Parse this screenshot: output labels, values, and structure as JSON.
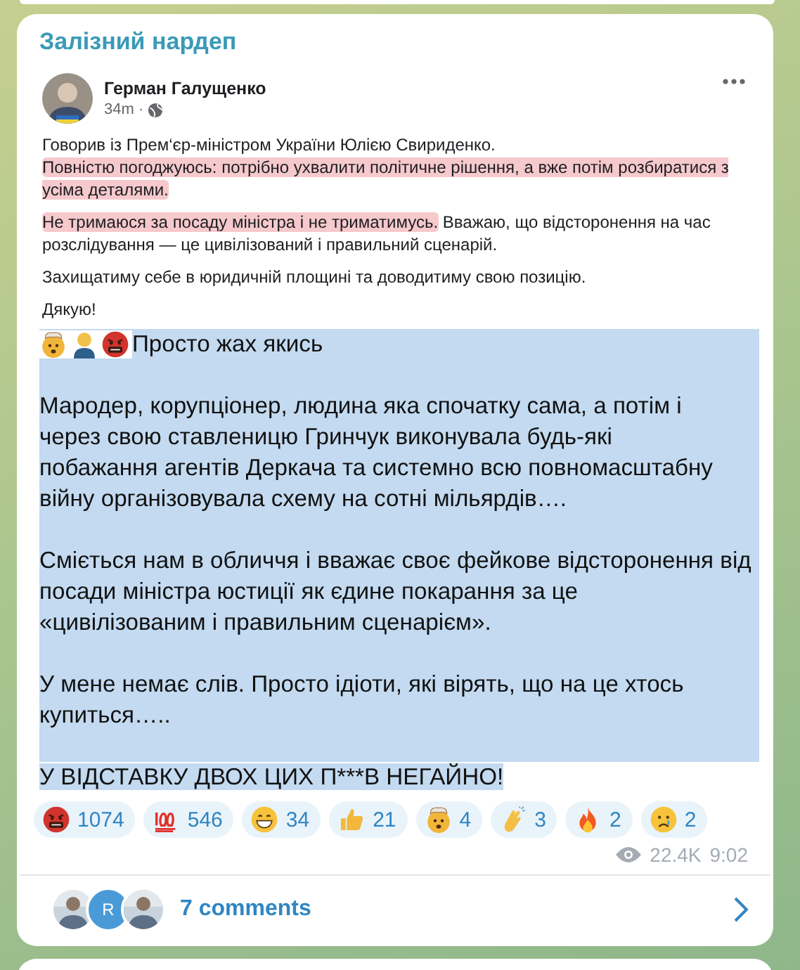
{
  "channel": {
    "title": "Залізний нардеп"
  },
  "post": {
    "author": "Герман Галущенко",
    "time": "34m ·",
    "paragraphs": [
      [
        {
          "text": "Говорив із Прем‘єр-міністром України Юлією Свириденко.",
          "highlighted": false
        },
        {
          "text": "Повністю погоджуюсь: потрібно ухвалити політичне рішення, а вже потім розбиратися з усіма деталями.",
          "highlighted": true
        }
      ],
      [
        {
          "text": "Не тримаюся за посаду міністра і не триматимусь.",
          "highlighted": true
        },
        {
          "text": " Вважаю, що відсторонення на час розслідування — це цивілізований і правильний сценарій.",
          "highlighted": false
        }
      ],
      [
        {
          "text": "Захищатиму себе в юридичній площині та доводитиму свою позицію.",
          "highlighted": false
        }
      ],
      [
        {
          "text": "Дякую!",
          "highlighted": false
        }
      ]
    ]
  },
  "message": {
    "selected": true,
    "lead_emoji": [
      {
        "kind": "mind-blown"
      },
      {
        "kind": "bald-person"
      },
      {
        "kind": "cursing"
      }
    ],
    "paragraphs": [
      [
        "Просто жах якись"
      ],
      [
        "Мародер, корупціонер, людина яка спочатку сама, а потім і",
        "через свою ставленицю Гринчук виконувала будь-які",
        "побажання агентів Деркача та системно всю повномасштабну",
        "війну організовувала схему на сотні мільярдів…."
      ],
      [
        "Сміється нам в обличчя і вважає своє фейкове відсторонення від",
        "посади міністра юстиції як єдине покарання за це",
        "«цивілізованим і правильним сценарієм»."
      ],
      [
        "У мене немає слів. Просто ідіоти, які вірять, що на це хтось",
        "купиться….."
      ],
      [
        "У ВІДСТАВКУ ДВОХ ЦИХ П***В НЕГАЙНО!"
      ]
    ]
  },
  "reactions": [
    {
      "kind": "cursing",
      "count": "1074"
    },
    {
      "kind": "hundred",
      "count": "546"
    },
    {
      "kind": "grin",
      "count": "34"
    },
    {
      "kind": "thumbs-up",
      "count": "21"
    },
    {
      "kind": "mind-blown",
      "count": "4"
    },
    {
      "kind": "clap",
      "count": "3"
    },
    {
      "kind": "fire",
      "count": "2"
    },
    {
      "kind": "cry",
      "count": "2"
    }
  ],
  "views": "22.4K",
  "time": "9:02",
  "comments": {
    "avatars": [
      {
        "kind": "picture"
      },
      {
        "kind": "letter",
        "letter": "R"
      },
      {
        "kind": "picture"
      }
    ],
    "label": "7 comments"
  }
}
